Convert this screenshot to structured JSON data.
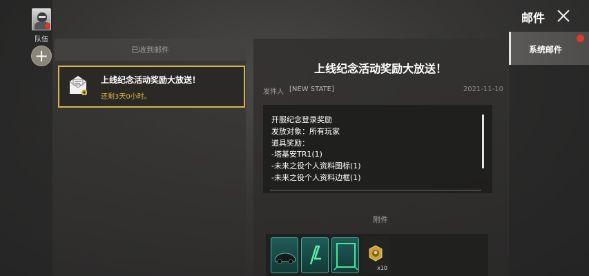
{
  "left_rail": {
    "team_label": "队伍",
    "add_symbol": "+"
  },
  "mail_list": {
    "header": "已收到邮件",
    "items": [
      {
        "title": "上线纪念活动奖励大放送！",
        "time_left": "还剩3天0小时。",
        "icon": "mail-envelope-icon"
      }
    ]
  },
  "mail_detail": {
    "title": "上线纪念活动奖励大放送！",
    "sender_label": "发件人",
    "sender_value": "[NEW STATE]",
    "date": "2021-11-10",
    "content_lines": [
      "开服纪念登录奖励",
      "发放对象：所有玩家",
      "道具奖励：",
      "-塔基安TR1(1)",
      "-未来之役个人资料图标(1)",
      "-未来之役个人资料边框(1)"
    ],
    "attachment_label": "附件",
    "attachments": [
      {
        "icon": "vehicle-skin-icon",
        "count": ""
      },
      {
        "icon": "profile-icon",
        "count": ""
      },
      {
        "icon": "profile-frame-icon",
        "count": ""
      },
      {
        "icon": "gold-medal-icon",
        "count": "x10"
      }
    ]
  },
  "header": {
    "title": "邮件"
  },
  "side_tabs": [
    {
      "label": "系统邮件"
    }
  ],
  "colors": {
    "accent_gold": "#d9b64a",
    "teal": "#3fb7a6",
    "notification_red": "#e03a2c"
  }
}
